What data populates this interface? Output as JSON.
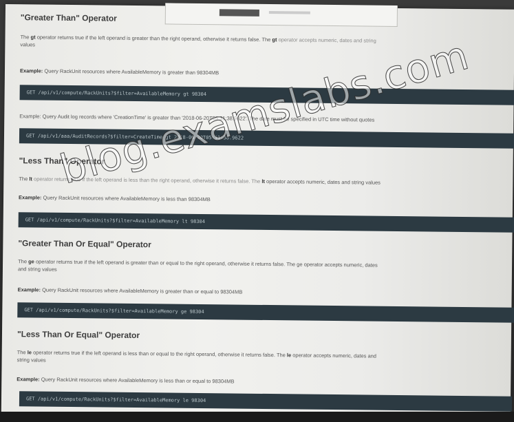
{
  "gt": {
    "heading": "\"Greater Than\" Operator",
    "desc_pre": "The",
    "op": "gt",
    "desc_mid": "operator returns true if the left operand is greater than the right operand, otherwise it returns false. The",
    "op2": "gt",
    "desc_post": "operator accepts numeric, dates and string",
    "desc_line2": "values",
    "example_label": "Example:",
    "example_text": "Query RackUnit resources where AvailableMemory is greater than 98304MB",
    "code": "GET /api/v1/compute/RackUnits?$filter=AvailableMemory gt 98304",
    "example2_text": "Example: Query Audit log records where 'CreationTime' is greater than '2018-06-20T05:31:38.9622'. The date must be specified in UTC time without quotes",
    "code2": "GET /api/v1/aaa/AuditRecords?$filter=CreateTime gt 2018-06-20T05:31:38.9622"
  },
  "lt": {
    "heading": "\"Less Than\" Operator",
    "desc_pre": "The",
    "op": "lt",
    "desc_mid": "operator returns true if the left operand is less than the right operand, otherwise it returns false. The",
    "op2": "lt",
    "desc_post": "operator accepts numeric, dates and string values",
    "example_label": "Example:",
    "example_text": "Query RackUnit resources where AvailableMemory is less than 98304MB",
    "code": "GET /api/v1/compute/RackUnits?$filter=AvailableMemory lt 98304"
  },
  "ge": {
    "heading": "\"Greater Than Or Equal\" Operator",
    "desc_pre": "The",
    "op": "ge",
    "desc_mid": "operator returns true if the left operand is greater than or equal to the right operand, otherwise it returns false. The ge operator accepts numeric, dates",
    "desc_line2": "and string values",
    "example_label": "Example:",
    "example_text": "Query RackUnit resources where AvailableMemory is greater than or equal to 98304MB",
    "code": "GET /api/v1/compute/RackUnits?$filter=AvailableMemory ge 98304"
  },
  "le": {
    "heading": "\"Less Than Or Equal\" Operator",
    "desc_pre": "The",
    "op": "le",
    "desc_mid": "operator returns true if the left operand is less than or equal to the right operand, otherwise it returns false. The",
    "op2": "le",
    "desc_post": "operator accepts numeric, dates and",
    "desc_line2": "string values",
    "example_label": "Example:",
    "example_text": "Query RackUnit resources where AvailableMemory is less than or equal to 98304MB",
    "code": "GET /api/v1/compute/RackUnits?$filter=AvailableMemory le 98304"
  },
  "watermark": "blog.examslabs.com"
}
